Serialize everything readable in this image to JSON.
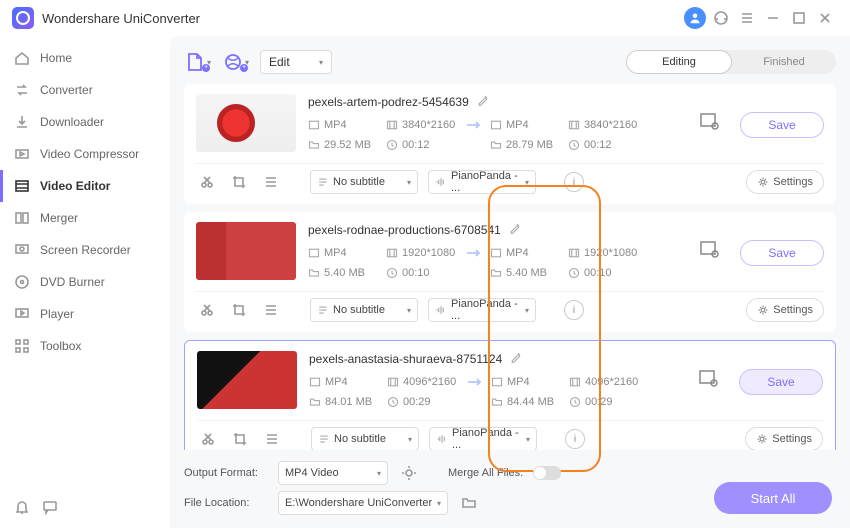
{
  "app": {
    "title": "Wondershare UniConverter"
  },
  "sidebar": {
    "items": [
      {
        "label": "Home"
      },
      {
        "label": "Converter"
      },
      {
        "label": "Downloader"
      },
      {
        "label": "Video Compressor"
      },
      {
        "label": "Video Editor"
      },
      {
        "label": "Merger"
      },
      {
        "label": "Screen Recorder"
      },
      {
        "label": "DVD Burner"
      },
      {
        "label": "Player"
      },
      {
        "label": "Toolbox"
      }
    ]
  },
  "toolbar": {
    "edit": "Edit",
    "tab_editing": "Editing",
    "tab_finished": "Finished"
  },
  "clips": [
    {
      "name": "pexels-artem-podrez-5454639",
      "in": {
        "fmt": "MP4",
        "res": "3840*2160",
        "size": "29.52 MB",
        "dur": "00:12"
      },
      "out": {
        "fmt": "MP4",
        "res": "3840*2160",
        "size": "28.79 MB",
        "dur": "00:12"
      },
      "sub": "No subtitle",
      "audio": "PianoPanda - ...",
      "save": "Save",
      "settings": "Settings"
    },
    {
      "name": "pexels-rodnae-productions-6708541",
      "in": {
        "fmt": "MP4",
        "res": "1920*1080",
        "size": "5.40 MB",
        "dur": "00:10"
      },
      "out": {
        "fmt": "MP4",
        "res": "1920*1080",
        "size": "5.40 MB",
        "dur": "00:10"
      },
      "sub": "No subtitle",
      "audio": "PianoPanda - ...",
      "save": "Save",
      "settings": "Settings"
    },
    {
      "name": "pexels-anastasia-shuraeva-8751124",
      "in": {
        "fmt": "MP4",
        "res": "4096*2160",
        "size": "84.01 MB",
        "dur": "00:29"
      },
      "out": {
        "fmt": "MP4",
        "res": "4096*2160",
        "size": "84.44 MB",
        "dur": "00:29"
      },
      "sub": "No subtitle",
      "audio": "PianoPanda - ...",
      "save": "Save",
      "settings": "Settings"
    }
  ],
  "bottom": {
    "out_fmt_label": "Output Format:",
    "out_fmt": "MP4 Video",
    "merge_label": "Merge All Files:",
    "loc_label": "File Location:",
    "loc": "E:\\Wondershare UniConverter",
    "start": "Start All"
  }
}
